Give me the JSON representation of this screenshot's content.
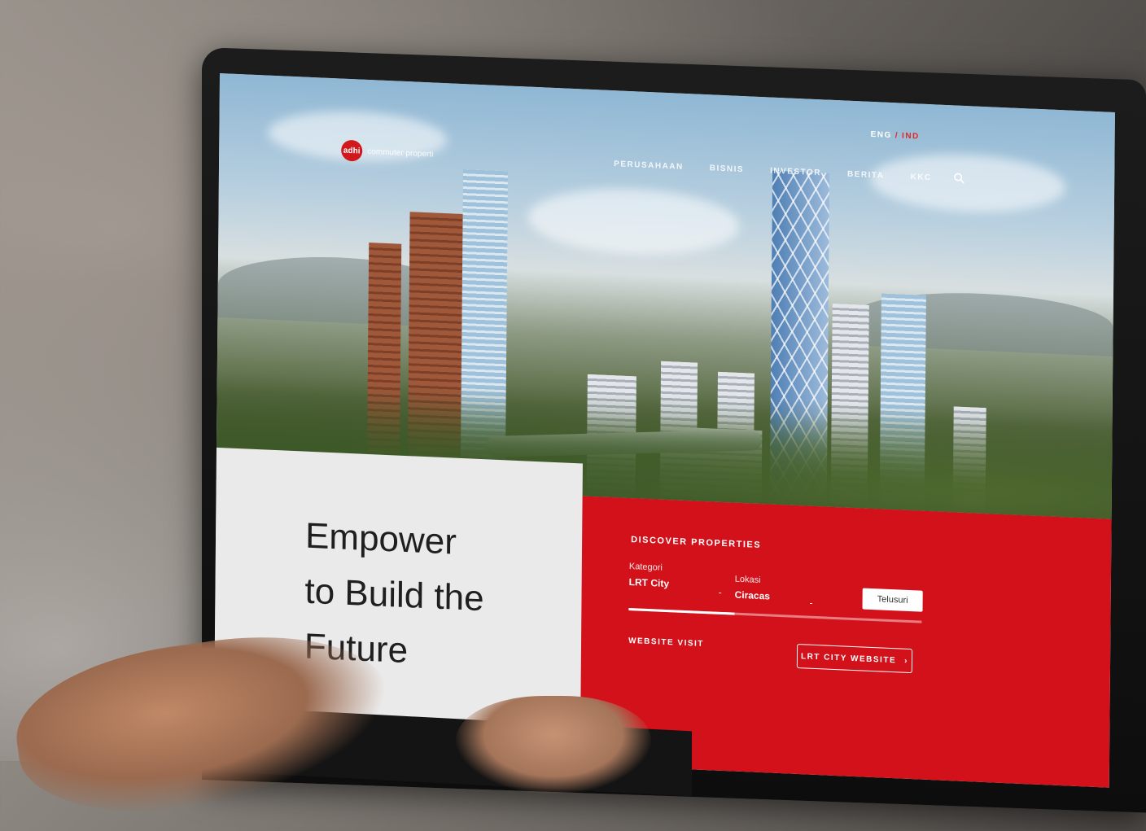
{
  "header": {
    "logo_mark": "adhi",
    "logo_text": "commuter properti",
    "nav": [
      "PERUSAHAAN",
      "BISNIS",
      "INVESTOR",
      "BERITA",
      "KKC"
    ],
    "lang_en": "ENG",
    "lang_sep": "/",
    "lang_ind": "IND"
  },
  "hero": {
    "headline_line1": "Empower",
    "headline_line2": "to Build the Future"
  },
  "discover": {
    "title": "DISCOVER PROPERTIES",
    "kategori_label": "Kategori",
    "kategori_value": "LRT City",
    "lokasi_label": "Lokasi",
    "lokasi_value": "Ciracas",
    "dash1": "-",
    "dash2": "-",
    "progress": 0.36,
    "search_button": "Telusuri",
    "website_visit_label": "WEBSITE VISIT",
    "website_button": "LRT CITY WEBSITE",
    "website_button_arrow": "›"
  },
  "colors": {
    "brand_red": "#d3111a",
    "light_panel": "#eaeaea"
  }
}
